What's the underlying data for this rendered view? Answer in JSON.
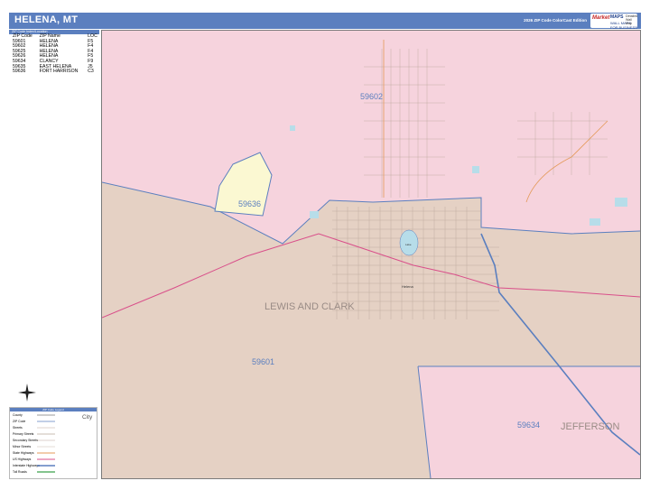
{
  "header": {
    "title": "HELENA, MT",
    "edition": "2026 ZIP Code ColorCast Edition",
    "logo_text": "Market",
    "logo_text2": "MAPS",
    "logo_tag": "WALL MAPS FOR BUSINESS",
    "logo_badge": "Detailed Wall Map"
  },
  "zip_table": {
    "bar_label": "ZIP Code Index/Location",
    "headers": [
      "ZIP Code",
      "ZIP Name",
      "LOC"
    ],
    "rows": [
      [
        "59601",
        "HELENA",
        "F5"
      ],
      [
        "59602",
        "HELENA",
        "F4"
      ],
      [
        "59625",
        "HELENA",
        "F4"
      ],
      [
        "59626",
        "HELENA",
        "F5"
      ],
      [
        "59634",
        "CLANCY",
        "F9"
      ],
      [
        "59635",
        "EAST HELENA",
        "J5"
      ],
      [
        "59636",
        "FORT HARRISON",
        "C3"
      ]
    ]
  },
  "map": {
    "colors": {
      "pink": "#f6d3dd",
      "tan": "#e5d1c4",
      "yellow": "#fbf8d2",
      "water": "#b7dde9",
      "zip_border": "#5b7fbf",
      "highway": "#5b7fbf",
      "us_highway": "#d94f8a",
      "arterial": "#e49a5a"
    },
    "labels": {
      "zip_59602": "59602",
      "zip_59636": "59636",
      "zip_59601": "59601",
      "zip_59634": "59634",
      "county_lewis_and_clark": "LEWIS AND CLARK",
      "county_jefferson": "JEFFERSON",
      "city_helena": "Helena",
      "lake": "Lake"
    }
  },
  "legend": {
    "bar_label": "ZIP Code Legend",
    "items": [
      "County",
      "ZIP Code",
      "Streets",
      "Primary Streets",
      "Secondary Streets",
      "Minor Streets",
      "State Highways",
      "US Highways",
      "Interstate Highways",
      "Toll Roads"
    ],
    "city_sample": "City"
  }
}
